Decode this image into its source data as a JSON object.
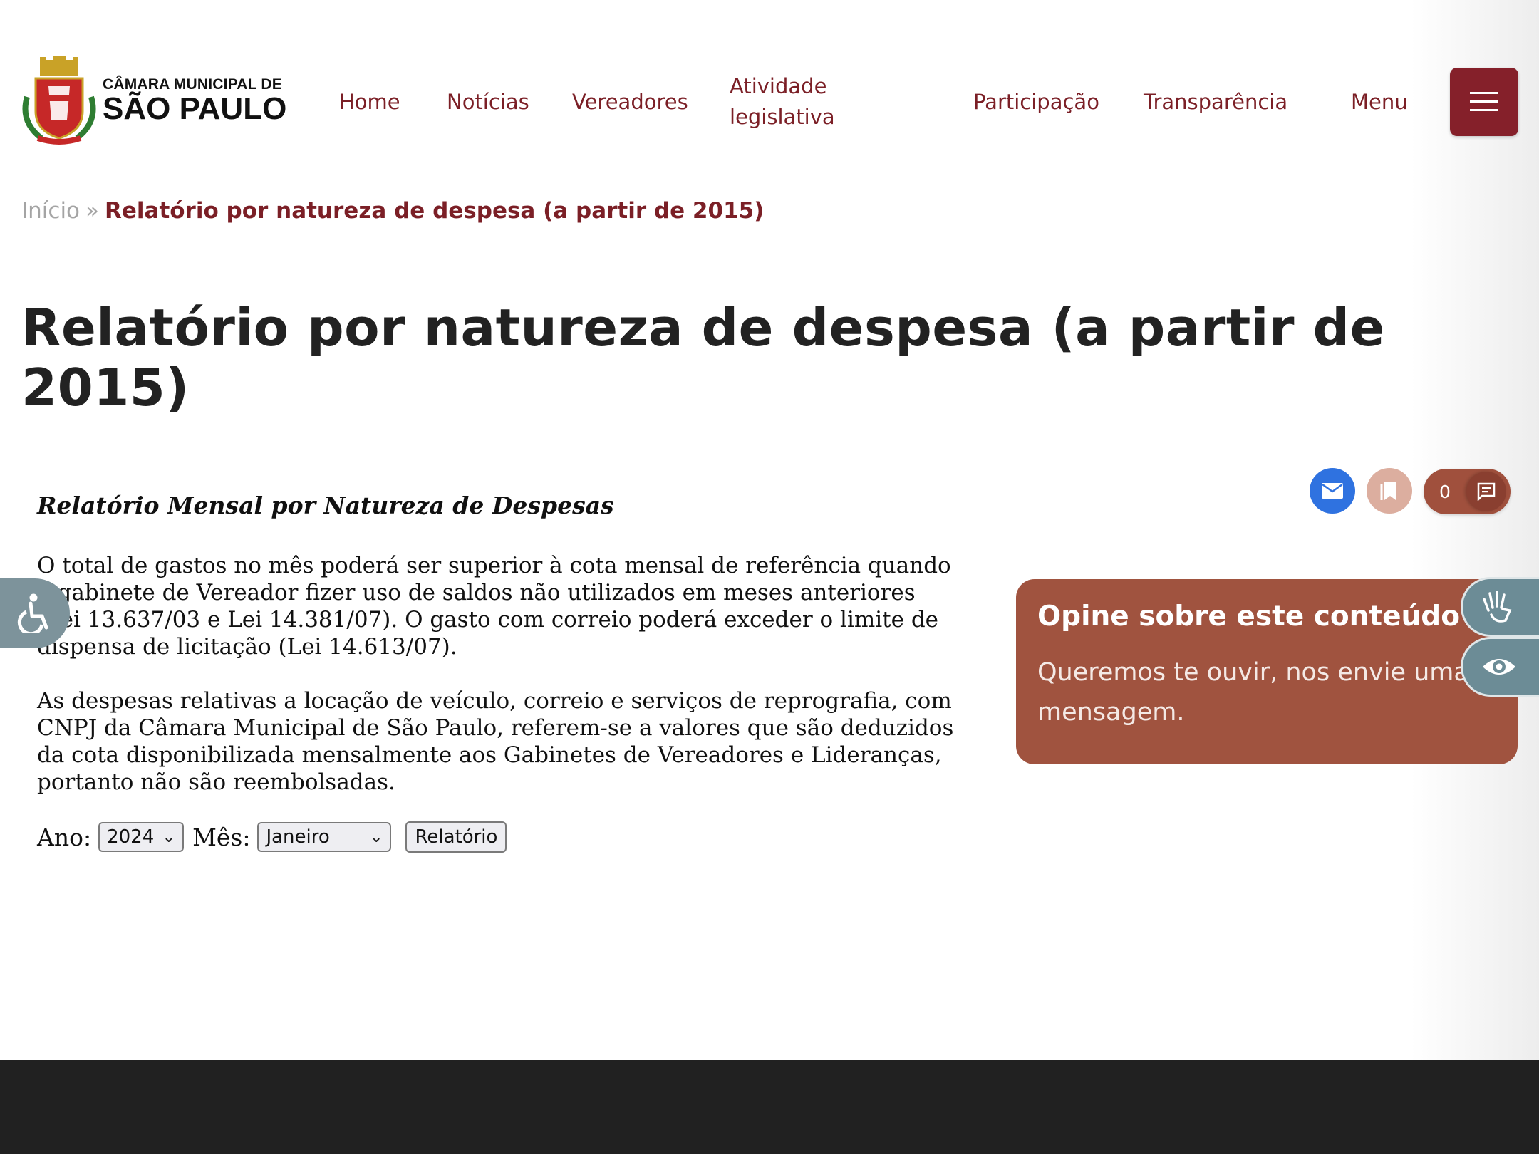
{
  "brand": {
    "line1": "CÂMARA MUNICIPAL DE",
    "line2": "SÃO PAULO"
  },
  "nav": {
    "items": [
      "Home",
      "Notícias",
      "Vereadores",
      "Atividade legislativa",
      "Participação",
      "Transparência"
    ],
    "menu_label": "Menu"
  },
  "breadcrumb": {
    "home": "Início",
    "separator": "»",
    "current": "Relatório por natureza de despesa (a partir de 2015)"
  },
  "page": {
    "title": "Relatório por natureza de despesa (a partir de 2015)"
  },
  "content": {
    "heading": "Relatório Mensal por Natureza de Despesas",
    "paragraph1": "O total de gastos no mês poderá ser superior à cota mensal de referência quando o gabinete de Vereador fizer uso de saldos não utilizados em meses anteriores (Lei 13.637/03 e Lei 14.381/07). O gasto com correio poderá exceder o limite de dispensa de licitação (Lei 14.613/07).",
    "paragraph2": "As despesas relativas a locação de veículo, correio e serviços de reprografia, com CNPJ da Câmara Municipal de São Paulo, referem-se a valores que são deduzidos da cota disponibilizada mensalmente aos Gabinetes de Vereadores e Lideranças, portanto não são reembolsadas."
  },
  "form": {
    "year_label": "Ano:",
    "year_value": "2024",
    "month_label": "Mês:",
    "month_value": "Janeiro",
    "submit_label": "Relatório"
  },
  "share": {
    "comment_count": "0",
    "icons": [
      "email-icon",
      "bookmark-icon",
      "comment-icon"
    ]
  },
  "feedback": {
    "title": "Opine sobre este conteúdo",
    "text": "Queremos te ouvir, nos envie uma mensagem."
  },
  "colors": {
    "brand": "#85202a",
    "card": "#a0533f",
    "email": "#2f72e0",
    "bookmark": "#dcae9f",
    "side_widget": "#6c8c96",
    "footer": "#212121"
  }
}
